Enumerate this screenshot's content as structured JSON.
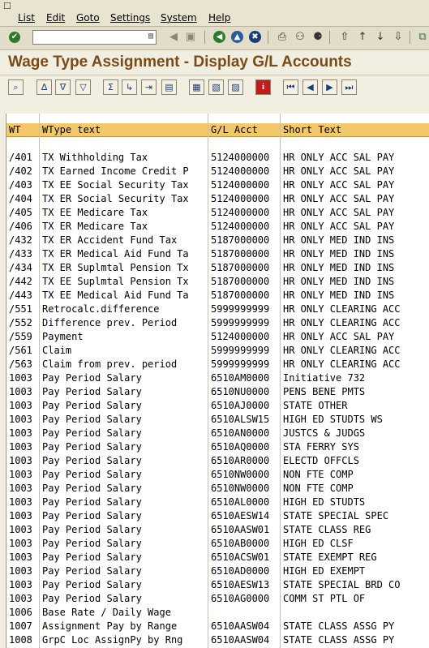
{
  "menu": {
    "items": [
      "List",
      "Edit",
      "Goto",
      "Settings",
      "System",
      "Help"
    ]
  },
  "toolbar": {
    "command_value": ""
  },
  "title": "Wage Type Assignment - Display G/L Accounts",
  "table": {
    "columns": [
      "WT",
      "WType text",
      "G/L Acct",
      "Short Text"
    ],
    "rows": [
      [
        "/401",
        "TX Withholding Tax",
        "5124000000",
        "HR ONLY ACC SAL PAY"
      ],
      [
        "/402",
        "TX Earned Income Credit P",
        "5124000000",
        "HR ONLY ACC SAL PAY"
      ],
      [
        "/403",
        "TX EE Social Security Tax",
        "5124000000",
        "HR ONLY ACC SAL PAY"
      ],
      [
        "/404",
        "TX ER Social Security Tax",
        "5124000000",
        "HR ONLY ACC SAL PAY"
      ],
      [
        "/405",
        "TX EE Medicare Tax",
        "5124000000",
        "HR ONLY ACC SAL PAY"
      ],
      [
        "/406",
        "TX ER Medicare Tax",
        "5124000000",
        "HR ONLY ACC SAL PAY"
      ],
      [
        "/432",
        "TX ER Accident Fund Tax",
        "5187000000",
        "HR ONLY MED IND INS"
      ],
      [
        "/433",
        "TX ER Medical Aid Fund Ta",
        "5187000000",
        "HR ONLY MED IND INS"
      ],
      [
        "/434",
        "TX ER Suplmtal Pension Tx",
        "5187000000",
        "HR ONLY MED IND INS"
      ],
      [
        "/442",
        "TX EE Suplmtal Pension Tx",
        "5187000000",
        "HR ONLY MED IND INS"
      ],
      [
        "/443",
        "TX EE Medical Aid Fund Ta",
        "5187000000",
        "HR ONLY MED IND INS"
      ],
      [
        "/551",
        "Retrocalc.difference",
        "5999999999",
        "HR ONLY CLEARING ACC"
      ],
      [
        "/552",
        "Difference prev. Period",
        "5999999999",
        "HR ONLY CLEARING ACC"
      ],
      [
        "/559",
        "Payment",
        "5124000000",
        "HR ONLY ACC SAL PAY"
      ],
      [
        "/561",
        "Claim",
        "5999999999",
        "HR ONLY CLEARING ACC"
      ],
      [
        "/563",
        "Claim from prev. period",
        "5999999999",
        "HR ONLY CLEARING ACC"
      ],
      [
        "1003",
        "Pay Period Salary",
        "6510AM0000",
        "Initiative 732"
      ],
      [
        "1003",
        "Pay Period Salary",
        "6510NU0000",
        "PENS BENE PMTS"
      ],
      [
        "1003",
        "Pay Period Salary",
        "6510AJ0000",
        "STATE OTHER"
      ],
      [
        "1003",
        "Pay Period Salary",
        "6510ALSW15",
        "HIGH ED STUDTS WS"
      ],
      [
        "1003",
        "Pay Period Salary",
        "6510AN0000",
        "JUSTCS & JUDGS"
      ],
      [
        "1003",
        "Pay Period Salary",
        "6510AQ0000",
        "STA FERRY SYS"
      ],
      [
        "1003",
        "Pay Period Salary",
        "6510AR0000",
        "ELECTD OFFCLS"
      ],
      [
        "1003",
        "Pay Period Salary",
        "6510NW0000",
        "NON FTE COMP"
      ],
      [
        "1003",
        "Pay Period Salary",
        "6510NW0000",
        "NON FTE COMP"
      ],
      [
        "1003",
        "Pay Period Salary",
        "6510AL0000",
        "HIGH ED STUDTS"
      ],
      [
        "1003",
        "Pay Period Salary",
        "6510AESW14",
        "STATE SPECIAL SPEC"
      ],
      [
        "1003",
        "Pay Period Salary",
        "6510AASW01",
        "STATE CLASS REG"
      ],
      [
        "1003",
        "Pay Period Salary",
        "6510AB0000",
        "HIGH ED CLSF"
      ],
      [
        "1003",
        "Pay Period Salary",
        "6510ACSW01",
        "STATE EXEMPT REG"
      ],
      [
        "1003",
        "Pay Period Salary",
        "6510AD0000",
        "HIGH ED EXEMPT"
      ],
      [
        "1003",
        "Pay Period Salary",
        "6510AESW13",
        "STATE SPECIAL BRD CO"
      ],
      [
        "1003",
        "Pay Period Salary",
        "6510AG0000",
        "COMM ST PTL OF"
      ],
      [
        "1006",
        "Base Rate / Daily Wage",
        "",
        ""
      ],
      [
        "1007",
        "Assignment Pay by Range",
        "6510AASW04",
        "STATE CLASS ASSG PY"
      ],
      [
        "1008",
        "GrpC Loc AssignPy by Rng",
        "6510AASW04",
        "STATE CLASS ASSG PY"
      ]
    ]
  }
}
